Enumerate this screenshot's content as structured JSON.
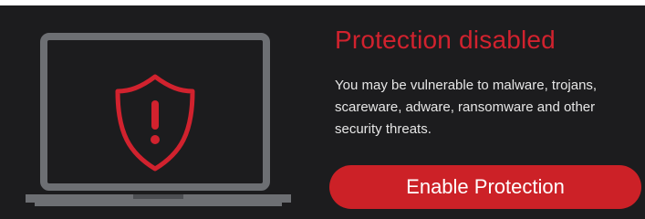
{
  "alert": {
    "title": "Protection disabled",
    "description_lines": [
      "You may be vulnerable to malware, trojans,",
      "scareware, adware, ransomware and other",
      "security threats."
    ],
    "enable_button_label": "Enable Protection",
    "shield_symbol": "!"
  },
  "icons": {
    "laptop": "laptop-icon",
    "shield": "shield-warning-icon"
  },
  "colors": {
    "accent": "#cc2127",
    "title": "#d1222e",
    "background": "#1c1c1e",
    "laptop": "#6d6f73",
    "text": "#e6e6e6"
  }
}
